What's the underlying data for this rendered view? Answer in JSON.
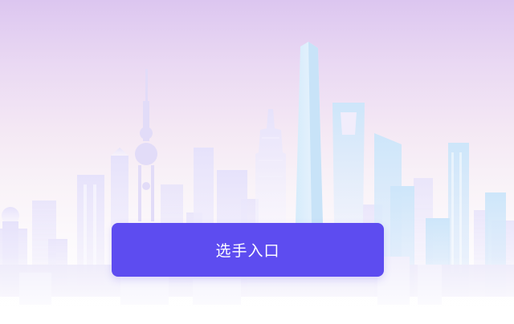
{
  "entry_button": {
    "label": "选手入口",
    "color": "#5d4cf0"
  },
  "background": {
    "top_color": "#dcc6f0",
    "bottom_color": "#ffffff",
    "illustration": "city-skyline"
  }
}
